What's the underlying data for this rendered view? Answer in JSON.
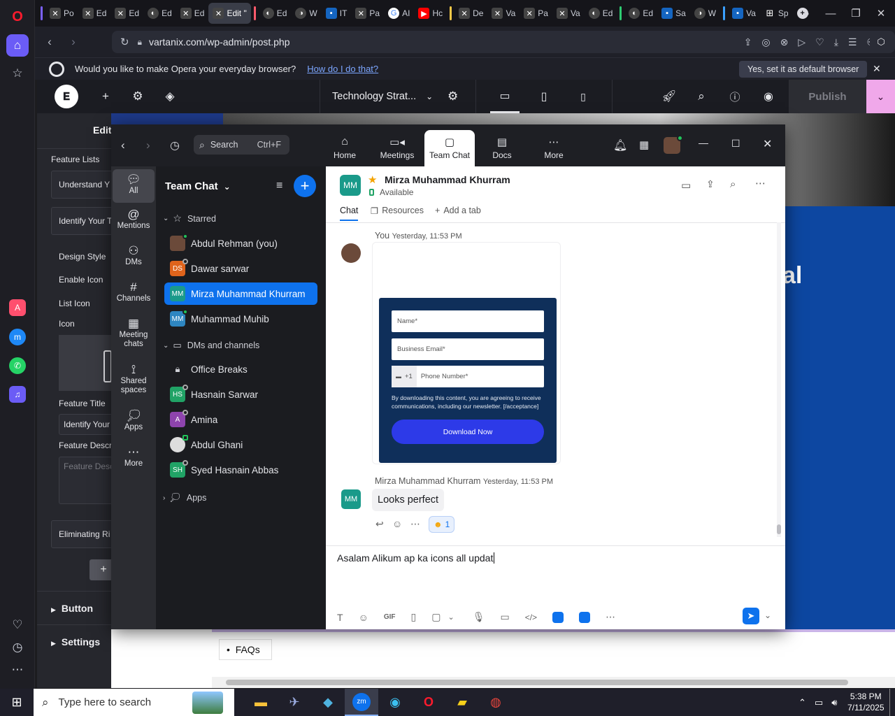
{
  "browser": {
    "tabs": [
      "Po",
      "Ed",
      "Ed",
      "Ed",
      "Ed",
      "Edit \"",
      "Ed",
      "W",
      "IT",
      "Pa",
      "AI",
      "Hc",
      "De",
      "Va",
      "Pa",
      "Va",
      "Ed",
      "Ed",
      "Sa",
      "W",
      "Va",
      "Sp"
    ],
    "url": "vartanix.com/wp-admin/post.php",
    "prompt_text": "Would you like to make Opera your everyday browser?",
    "prompt_link": "How do I do that?",
    "prompt_button": "Yes, set it as default browser"
  },
  "elementor": {
    "doc_title": "Technology Strat...",
    "publish_label": "Publish",
    "panel_title": "Edit",
    "items": {
      "feature_lists": "Feature Lists",
      "understand": "Understand Y",
      "identify": "Identify Your T",
      "design_style": "Design Style",
      "enable_icon": "Enable Icon",
      "list_icon": "List Icon",
      "icon": "Icon",
      "feature_title": "Feature Title",
      "feature_title_value": "Identify Your",
      "feature_desc": "Feature Descr",
      "feature_desc_placeholder": "Feature Desc",
      "eliminating": "Eliminating Ri",
      "button": "Button",
      "settings": "Settings"
    },
    "canvas": {
      "faqs": "FAQs",
      "heading_fragment": "al"
    }
  },
  "zoom": {
    "search_placeholder": "Search",
    "search_shortcut": "Ctrl+F",
    "nav": [
      {
        "label": "Home",
        "icon": "home-icon"
      },
      {
        "label": "Meetings",
        "icon": "video-icon"
      },
      {
        "label": "Team Chat",
        "icon": "chat-icon"
      },
      {
        "label": "Docs",
        "icon": "doc-icon"
      },
      {
        "label": "More",
        "icon": "more-icon"
      }
    ],
    "rail": {
      "all": "All",
      "mentions": "Mentions",
      "dms": "DMs",
      "channels": "Channels",
      "meeting_chats": "Meeting chats",
      "shared_spaces": "Shared spaces",
      "apps": "Apps",
      "more": "More"
    },
    "list": {
      "title": "Team Chat",
      "starred": "Starred",
      "dms_channels": "DMs and channels",
      "apps": "Apps",
      "starred_items": [
        {
          "initials": "",
          "name": "Abdul Rehman (you)",
          "color": "#6b4a3a"
        },
        {
          "initials": "DS",
          "name": "Dawar sarwar",
          "color": "#e0641c"
        },
        {
          "initials": "MM",
          "name": "Mirza Muhammad Khurram",
          "color": "#1a9a8a"
        },
        {
          "initials": "MM",
          "name": "Muhammad Muhib",
          "color": "#2e86c1"
        }
      ],
      "channel_items": [
        {
          "initials": "",
          "name": "Office Breaks",
          "color": "#1b1c20"
        },
        {
          "initials": "HS",
          "name": "Hasnain Sarwar",
          "color": "#21a366"
        },
        {
          "initials": "A",
          "name": "Amina",
          "color": "#8e44ad"
        },
        {
          "initials": "",
          "name": "Abdul Ghani",
          "color": "#ddd"
        },
        {
          "initials": "SH",
          "name": "Syed Hasnain Abbas",
          "color": "#21a366"
        }
      ]
    },
    "chat": {
      "contact_initials": "MM",
      "contact_name": "Mirza Muhammad Khurram",
      "status": "Available",
      "tabs": {
        "chat": "Chat",
        "resources": "Resources",
        "add_tab": "Add a tab"
      },
      "msg1_sender": "You",
      "msg1_time": "Yesterday, 11:53 PM",
      "form": {
        "name_placeholder": "Name*",
        "email_placeholder": "Business Email*",
        "phone_code": "+1",
        "phone_placeholder": "Phone Number*",
        "consent": "By downloading this content, you are agreeing to receive communications, including our newsletter. [/acceptance]",
        "button": "Download Now"
      },
      "msg2_sender": "Mirza Muhammad Khurram",
      "msg2_time": "Yesterday, 11:53 PM",
      "msg2_text": "Looks perfect",
      "reaction_count": "1",
      "composer_text": "Asalam Alikum ap ka icons all updat"
    }
  },
  "taskbar": {
    "search_placeholder": "Type here to search",
    "time": "5:38 PM",
    "date": "7/11/2025"
  },
  "colors": {
    "zoom_blue": "#0e72ed",
    "elementor_pink": "#f0a8ea",
    "form_bg": "#0f2f5a",
    "form_button": "#2d3ae8"
  }
}
